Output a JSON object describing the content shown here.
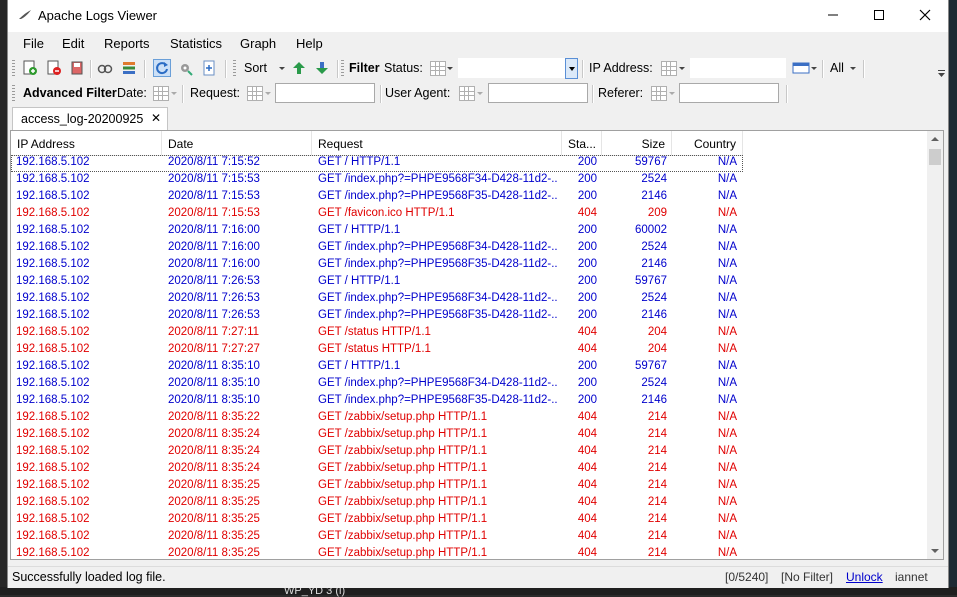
{
  "window": {
    "title": "Apache Logs Viewer"
  },
  "menu": [
    "File",
    "Edit",
    "Reports",
    "Statistics",
    "Graph",
    "Help"
  ],
  "toolbar": {
    "sort_label": "Sort",
    "filter_label": "Filter",
    "status_label": "Status:",
    "ip_label": "IP Address:",
    "all_label": "All"
  },
  "advanced_filter": {
    "title": "Advanced Filter",
    "date_label": "Date:",
    "request_label": "Request:",
    "user_agent_label": "User Agent:",
    "referer_label": "Referer:"
  },
  "tab": {
    "label": "access_log-20200925",
    "close": "✕"
  },
  "table": {
    "columns": [
      "IP Address",
      "Date",
      "Request",
      "Sta...",
      "Size",
      "Country"
    ],
    "rows": [
      [
        "192.168.5.102",
        "2020/8/11 7:15:52",
        "GET / HTTP/1.1",
        "200",
        "59767",
        "N/A"
      ],
      [
        "192.168.5.102",
        "2020/8/11 7:15:53",
        "GET /index.php?=PHPE9568F34-D428-11d2-...",
        "200",
        "2524",
        "N/A"
      ],
      [
        "192.168.5.102",
        "2020/8/11 7:15:53",
        "GET /index.php?=PHPE9568F35-D428-11d2-...",
        "200",
        "2146",
        "N/A"
      ],
      [
        "192.168.5.102",
        "2020/8/11 7:15:53",
        "GET /favicon.ico HTTP/1.1",
        "404",
        "209",
        "N/A"
      ],
      [
        "192.168.5.102",
        "2020/8/11 7:16:00",
        "GET / HTTP/1.1",
        "200",
        "60002",
        "N/A"
      ],
      [
        "192.168.5.102",
        "2020/8/11 7:16:00",
        "GET /index.php?=PHPE9568F34-D428-11d2-...",
        "200",
        "2524",
        "N/A"
      ],
      [
        "192.168.5.102",
        "2020/8/11 7:16:00",
        "GET /index.php?=PHPE9568F35-D428-11d2-...",
        "200",
        "2146",
        "N/A"
      ],
      [
        "192.168.5.102",
        "2020/8/11 7:26:53",
        "GET / HTTP/1.1",
        "200",
        "59767",
        "N/A"
      ],
      [
        "192.168.5.102",
        "2020/8/11 7:26:53",
        "GET /index.php?=PHPE9568F34-D428-11d2-...",
        "200",
        "2524",
        "N/A"
      ],
      [
        "192.168.5.102",
        "2020/8/11 7:26:53",
        "GET /index.php?=PHPE9568F35-D428-11d2-...",
        "200",
        "2146",
        "N/A"
      ],
      [
        "192.168.5.102",
        "2020/8/11 7:27:11",
        "GET /status HTTP/1.1",
        "404",
        "204",
        "N/A"
      ],
      [
        "192.168.5.102",
        "2020/8/11 7:27:27",
        "GET /status HTTP/1.1",
        "404",
        "204",
        "N/A"
      ],
      [
        "192.168.5.102",
        "2020/8/11 8:35:10",
        "GET / HTTP/1.1",
        "200",
        "59767",
        "N/A"
      ],
      [
        "192.168.5.102",
        "2020/8/11 8:35:10",
        "GET /index.php?=PHPE9568F34-D428-11d2-...",
        "200",
        "2524",
        "N/A"
      ],
      [
        "192.168.5.102",
        "2020/8/11 8:35:10",
        "GET /index.php?=PHPE9568F35-D428-11d2-...",
        "200",
        "2146",
        "N/A"
      ],
      [
        "192.168.5.102",
        "2020/8/11 8:35:22",
        "GET /zabbix/setup.php HTTP/1.1",
        "404",
        "214",
        "N/A"
      ],
      [
        "192.168.5.102",
        "2020/8/11 8:35:24",
        "GET /zabbix/setup.php HTTP/1.1",
        "404",
        "214",
        "N/A"
      ],
      [
        "192.168.5.102",
        "2020/8/11 8:35:24",
        "GET /zabbix/setup.php HTTP/1.1",
        "404",
        "214",
        "N/A"
      ],
      [
        "192.168.5.102",
        "2020/8/11 8:35:24",
        "GET /zabbix/setup.php HTTP/1.1",
        "404",
        "214",
        "N/A"
      ],
      [
        "192.168.5.102",
        "2020/8/11 8:35:25",
        "GET /zabbix/setup.php HTTP/1.1",
        "404",
        "214",
        "N/A"
      ],
      [
        "192.168.5.102",
        "2020/8/11 8:35:25",
        "GET /zabbix/setup.php HTTP/1.1",
        "404",
        "214",
        "N/A"
      ],
      [
        "192.168.5.102",
        "2020/8/11 8:35:25",
        "GET /zabbix/setup.php HTTP/1.1",
        "404",
        "214",
        "N/A"
      ],
      [
        "192.168.5.102",
        "2020/8/11 8:35:25",
        "GET /zabbix/setup.php HTTP/1.1",
        "404",
        "214",
        "N/A"
      ],
      [
        "192.168.5.102",
        "2020/8/11 8:35:25",
        "GET /zabbix/setup.php HTTP/1.1",
        "404",
        "214",
        "N/A"
      ]
    ]
  },
  "colors": {
    "ok": "#0000cc",
    "error": "#e00000"
  },
  "status_bar": {
    "message": "Successfully loaded log file.",
    "count": "[0/5240]",
    "filter": "[No Filter]",
    "unlock": "Unlock",
    "extra": "iannet"
  },
  "background": {
    "taskbar_text": "WP_YD 3 (l)"
  },
  "icons": {
    "app": "feather-icon",
    "min": "minimize-icon",
    "max": "maximize-icon",
    "close": "close-icon",
    "toolbar": [
      "open-log-icon",
      "remove-log-icon",
      "save-icon",
      "find-icon",
      "list-icon",
      "refresh-icon",
      "settings-icon",
      "export-icon",
      "sort-asc-icon",
      "sort-desc-icon",
      "calendar-icon"
    ]
  }
}
